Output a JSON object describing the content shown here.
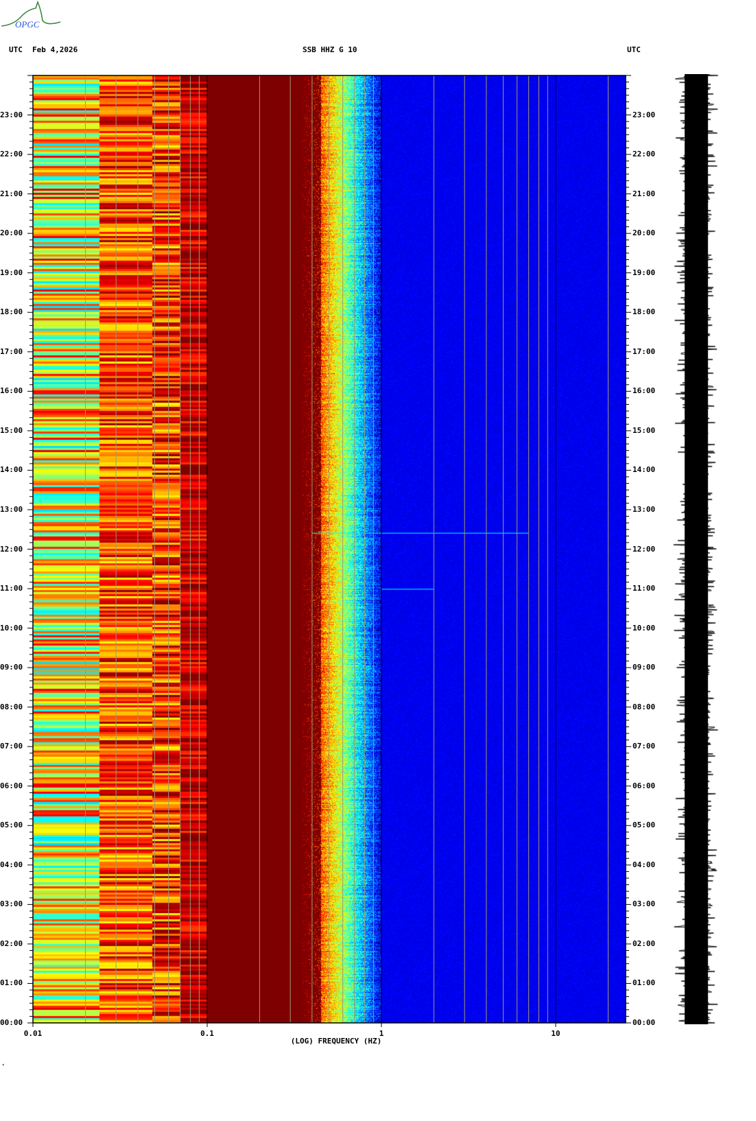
{
  "header": {
    "left_tz": "UTC",
    "date": "Feb 4,2026",
    "station": "SSB HHZ G 10",
    "right_tz": "UTC"
  },
  "logo": {
    "text": "OPGC"
  },
  "footer_mark": "*",
  "chart_data": {
    "type": "heatmap",
    "title": "SSB HHZ G 10",
    "xlabel": "(LOG) FREQUENCY (HZ)",
    "ylabel": "UTC",
    "xscale": "log",
    "xlim": [
      0.01,
      25
    ],
    "x_ticks": [
      {
        "value": 0.01,
        "label": "0.01"
      },
      {
        "value": 0.1,
        "label": "0.1"
      },
      {
        "value": 1,
        "label": "1"
      },
      {
        "value": 10,
        "label": "10"
      }
    ],
    "ylim_hours": [
      0,
      24
    ],
    "y_ticks": [
      "00:00",
      "01:00",
      "02:00",
      "03:00",
      "04:00",
      "05:00",
      "06:00",
      "07:00",
      "08:00",
      "09:00",
      "10:00",
      "11:00",
      "12:00",
      "13:00",
      "14:00",
      "15:00",
      "16:00",
      "17:00",
      "18:00",
      "19:00",
      "20:00",
      "21:00",
      "22:00",
      "23:00"
    ],
    "grid_freqs": [
      0.02,
      0.03,
      0.04,
      0.05,
      0.06,
      0.07,
      0.08,
      0.09,
      0.2,
      0.3,
      0.4,
      0.5,
      0.6,
      0.7,
      0.8,
      0.9,
      2,
      3,
      4,
      5,
      6,
      7,
      8,
      9,
      20
    ],
    "colormap": "jet",
    "colormap_stops": [
      "#00007f",
      "#0000ff",
      "#00ffff",
      "#ffff00",
      "#ff0000",
      "#7f0000"
    ],
    "power_profile": [
      {
        "freq_range": [
          0.01,
          0.024
        ],
        "level": "yellow-orange, high variability"
      },
      {
        "freq_range": [
          0.024,
          0.1
        ],
        "level": "red-orange"
      },
      {
        "freq_range": [
          0.1,
          0.35
        ],
        "level": "saturated dark red"
      },
      {
        "freq_range": [
          0.35,
          1
        ],
        "level": "transition yellow-cyan-blue"
      },
      {
        "freq_range": [
          1,
          25
        ],
        "level": "dark blue"
      }
    ],
    "events": [
      {
        "time": "12:25",
        "freq_range": [
          0.4,
          7
        ],
        "note": "narrow transient"
      },
      {
        "time": "11:00",
        "freq_range": [
          1,
          2
        ],
        "note": "narrow transient"
      }
    ],
    "seismogram": {
      "position": "right",
      "color": "#000000"
    }
  }
}
